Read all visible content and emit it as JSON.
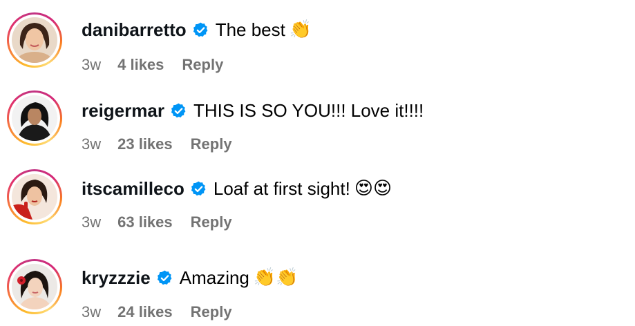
{
  "comments": [
    {
      "username": "danibarretto",
      "text": "The best",
      "emoji": "👏",
      "time": "3w",
      "likes": "4 likes",
      "reply": "Reply"
    },
    {
      "username": "reigermar",
      "text": "THIS IS SO YOU!!! Love it!!!!",
      "emoji": "",
      "time": "3w",
      "likes": "23 likes",
      "reply": "Reply"
    },
    {
      "username": "itscamilleco",
      "text": "Loaf at first sight!",
      "emoji": "😍😍",
      "time": "3w",
      "likes": "63 likes",
      "reply": "Reply"
    },
    {
      "username": "kryzzzie",
      "text": "Amazing",
      "emoji": "👏👏",
      "time": "3w",
      "likes": "24 likes",
      "reply": "Reply"
    }
  ],
  "colors": {
    "verified": "#0095f6",
    "meta": "#737373"
  },
  "icons": {
    "verified": "verified-badge-icon",
    "avatar": "profile-avatar"
  }
}
